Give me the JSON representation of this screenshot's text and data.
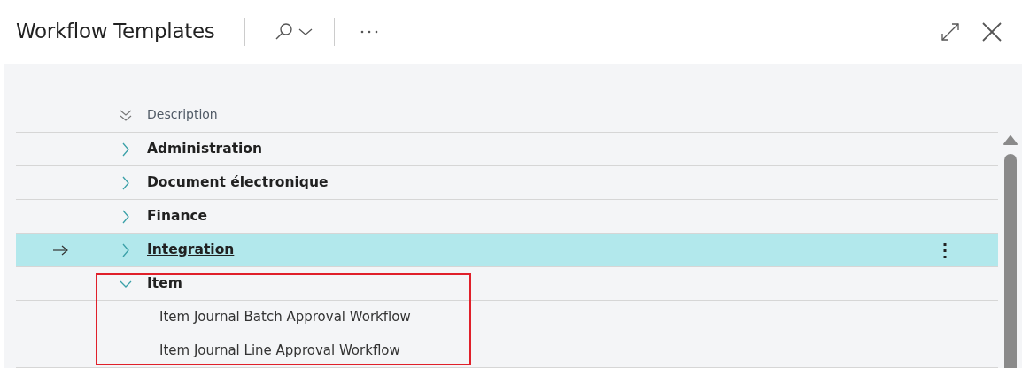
{
  "window": {
    "title": "Workflow Templates"
  },
  "table": {
    "columns": [
      {
        "label": "Description"
      }
    ],
    "rows": [
      {
        "label": "Administration",
        "expanded": false,
        "selected": false
      },
      {
        "label": "Document électronique",
        "expanded": false,
        "selected": false
      },
      {
        "label": "Finance",
        "expanded": false,
        "selected": false
      },
      {
        "label": "Integration",
        "expanded": false,
        "selected": true
      },
      {
        "label": "Item",
        "expanded": true,
        "selected": false,
        "children": [
          {
            "label": "Item Journal Batch Approval Workflow",
            "selected": false
          },
          {
            "label": "Item Journal Line Approval Workflow",
            "selected": false
          }
        ]
      }
    ]
  }
}
